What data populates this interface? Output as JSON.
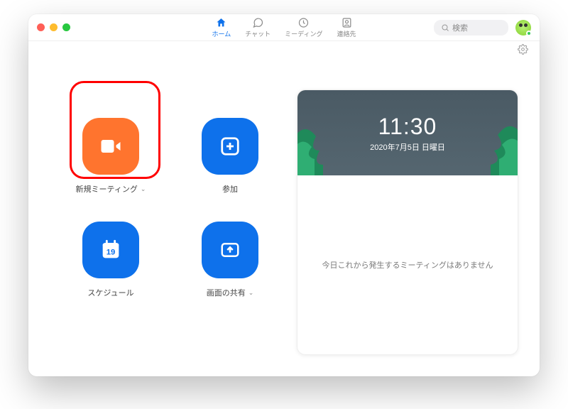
{
  "nav": {
    "home": "ホーム",
    "chat": "チャット",
    "meetings": "ミーディング",
    "contacts": "連絡先"
  },
  "search": {
    "placeholder": "検索"
  },
  "tiles": {
    "new_meeting": "新規ミーティング",
    "join": "参加",
    "schedule": "スケジュール",
    "schedule_day": "19",
    "share": "画面の共有"
  },
  "clock": {
    "time": "11:30",
    "date": "2020年7月5日 日曜日"
  },
  "panel": {
    "no_meetings": "今日これから発生するミーティングはありません"
  }
}
